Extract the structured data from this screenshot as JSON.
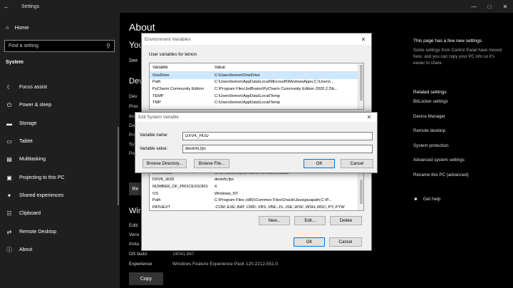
{
  "window": {
    "title": "Settings",
    "back_icon": "back-arrow-icon",
    "controls": [
      "minimize-icon",
      "maximize-icon",
      "close-icon"
    ]
  },
  "sidebar": {
    "home_label": "Home",
    "search_placeholder": "Find a setting",
    "section": "System",
    "items": [
      {
        "label": "Focus assist",
        "icon": "moon-icon"
      },
      {
        "label": "Power & sleep",
        "icon": "power-icon"
      },
      {
        "label": "Storage",
        "icon": "storage-icon"
      },
      {
        "label": "Tablet",
        "icon": "tablet-icon"
      },
      {
        "label": "Multitasking",
        "icon": "multitasking-icon"
      },
      {
        "label": "Projecting to this PC",
        "icon": "projecting-icon"
      },
      {
        "label": "Shared experiences",
        "icon": "shared-icon"
      },
      {
        "label": "Clipboard",
        "icon": "clipboard-icon"
      },
      {
        "label": "Remote Desktop",
        "icon": "remote-icon"
      },
      {
        "label": "About",
        "icon": "info-icon"
      }
    ]
  },
  "main": {
    "title": "About",
    "frag_you": "You",
    "frag_see": "See",
    "frag_dev": "Devi",
    "frag_win": "Win",
    "rename_label": "Re",
    "spec_rows": [
      {
        "label": "Dev",
        "value": ""
      },
      {
        "label": "Proc",
        "value": ""
      },
      {
        "label": "Inst",
        "value": ""
      },
      {
        "label": "Devi",
        "value": ""
      },
      {
        "label": "Prod",
        "value": ""
      },
      {
        "label": "Syst",
        "value": ""
      },
      {
        "label": "Pen",
        "value": ""
      }
    ],
    "win_rows": [
      {
        "label": "Editi",
        "value": ""
      },
      {
        "label": "Versi",
        "value": ""
      },
      {
        "label": "Insta",
        "value": ""
      },
      {
        "label": "OS build",
        "value": "19041.867"
      },
      {
        "label": "Experience",
        "value": "Windows Feature Experience Pack 120.2212.551.0"
      }
    ],
    "copy_label": "Copy"
  },
  "right_panel": {
    "notice_title": "This page has a few new settings",
    "notice_text": "Some settings from Control Panel have moved here, and you can copy your PC info so it's easier to share.",
    "related_title": "Related settings",
    "related_links": [
      "BitLocker settings",
      "Device Manager",
      "Remote desktop",
      "System protection",
      "Advanced system settings",
      "Rename this PC (advanced)"
    ],
    "help_label": "Get help",
    "help_icon": "help-icon"
  },
  "env_dialog": {
    "title": "Environment Variables",
    "user_label": "User variables for lemon",
    "headers": [
      "Variable",
      "Value"
    ],
    "user_rows": [
      [
        "OneDrive",
        "C:\\Users\\lemon\\OneDrive"
      ],
      [
        "Path",
        "C:\\Users\\lemon\\AppData\\Local\\Microsoft\\WindowsApps;C:\\Users\\..."
      ],
      [
        "PyCharm Community Edition",
        "C:\\Program Files\\JetBrains\\PyCharm Community Edition 2020.2.2\\b..."
      ],
      [
        "TEMP",
        "C:\\Users\\lemon\\AppData\\Local\\Temp"
      ],
      [
        "TMP",
        "C:\\Users\\lemon\\AppData\\Local\\Temp"
      ]
    ],
    "system_rows": [
      [
        "DriverData",
        "C:\\Windows\\System32\\Drivers\\DriverData"
      ],
      [
        "DXVK_HUD",
        "devinfo,fps"
      ],
      [
        "NUMBER_OF_PROCESSORS",
        "4"
      ],
      [
        "OS",
        "Windows_NT"
      ],
      [
        "Path",
        "C:\\Program Files (x86)\\Common Files\\Oracle\\Java\\javapath;C:\\P..."
      ],
      [
        "PATHEXT",
        ".COM;.EXE;.BAT;.CMD;.VBS;.VBE;.JS;.JSE;.WSF;.WSH;.MSC;.PY;.PYW"
      ]
    ],
    "system_buttons": [
      "New...",
      "Edit...",
      "Delete"
    ],
    "ok_label": "OK",
    "cancel_label": "Cancel"
  },
  "edit_dialog": {
    "title": "Edit System Variable",
    "name_label": "Variable name:",
    "name_value": "DXVK_HUD",
    "value_label": "Variable value:",
    "value_value": "devinfo,fps",
    "browse_dir": "Browse Directory...",
    "browse_file": "Browse File...",
    "ok_label": "OK",
    "cancel_label": "Cancel"
  }
}
